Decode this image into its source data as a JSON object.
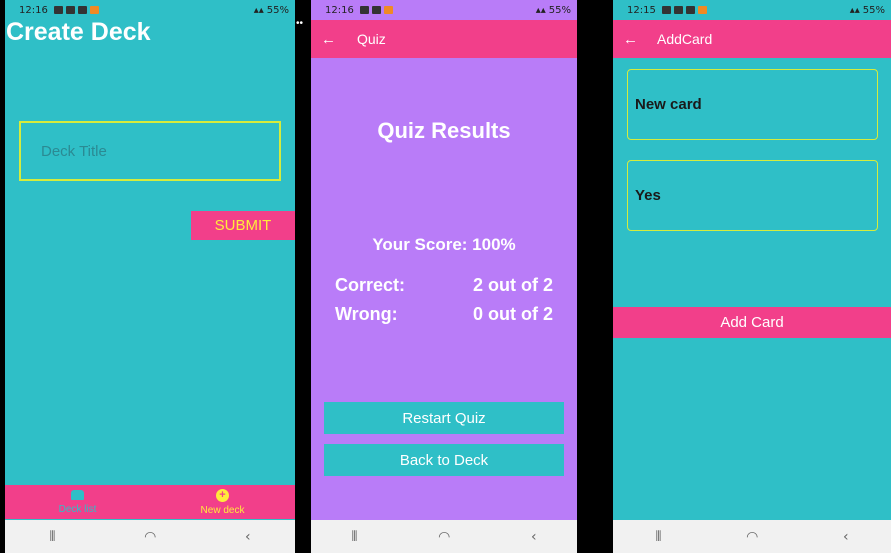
{
  "screen1": {
    "status": {
      "time": "12:16",
      "battery": "55%"
    },
    "title": "Create Deck",
    "deck_title_placeholder": "Deck Title",
    "submit_label": "SUBMIT",
    "tabs": [
      {
        "label": "Deck list",
        "icon": "deck-icon"
      },
      {
        "label": "New deck",
        "icon": "plus-circle-icon"
      }
    ]
  },
  "screen2": {
    "status": {
      "time": "12:16",
      "battery": "55%"
    },
    "appbar_title": "Quiz",
    "results_title": "Quiz Results",
    "score": "Your Score: 100%",
    "correct_label": "Correct:",
    "correct_value": "2 out of 2",
    "wrong_label": "Wrong:",
    "wrong_value": "0 out of 2",
    "restart_label": "Restart Quiz",
    "back_label": "Back to Deck"
  },
  "screen3": {
    "status": {
      "time": "12:15",
      "battery": "55%"
    },
    "appbar_title": "AddCard",
    "question_value": "New card",
    "answer_value": "Yes",
    "add_label": "Add Card"
  },
  "colors": {
    "teal": "#2fbfc7",
    "pink": "#f23f8a",
    "purple": "#b97cf8",
    "yellow": "#ffeb3b"
  }
}
